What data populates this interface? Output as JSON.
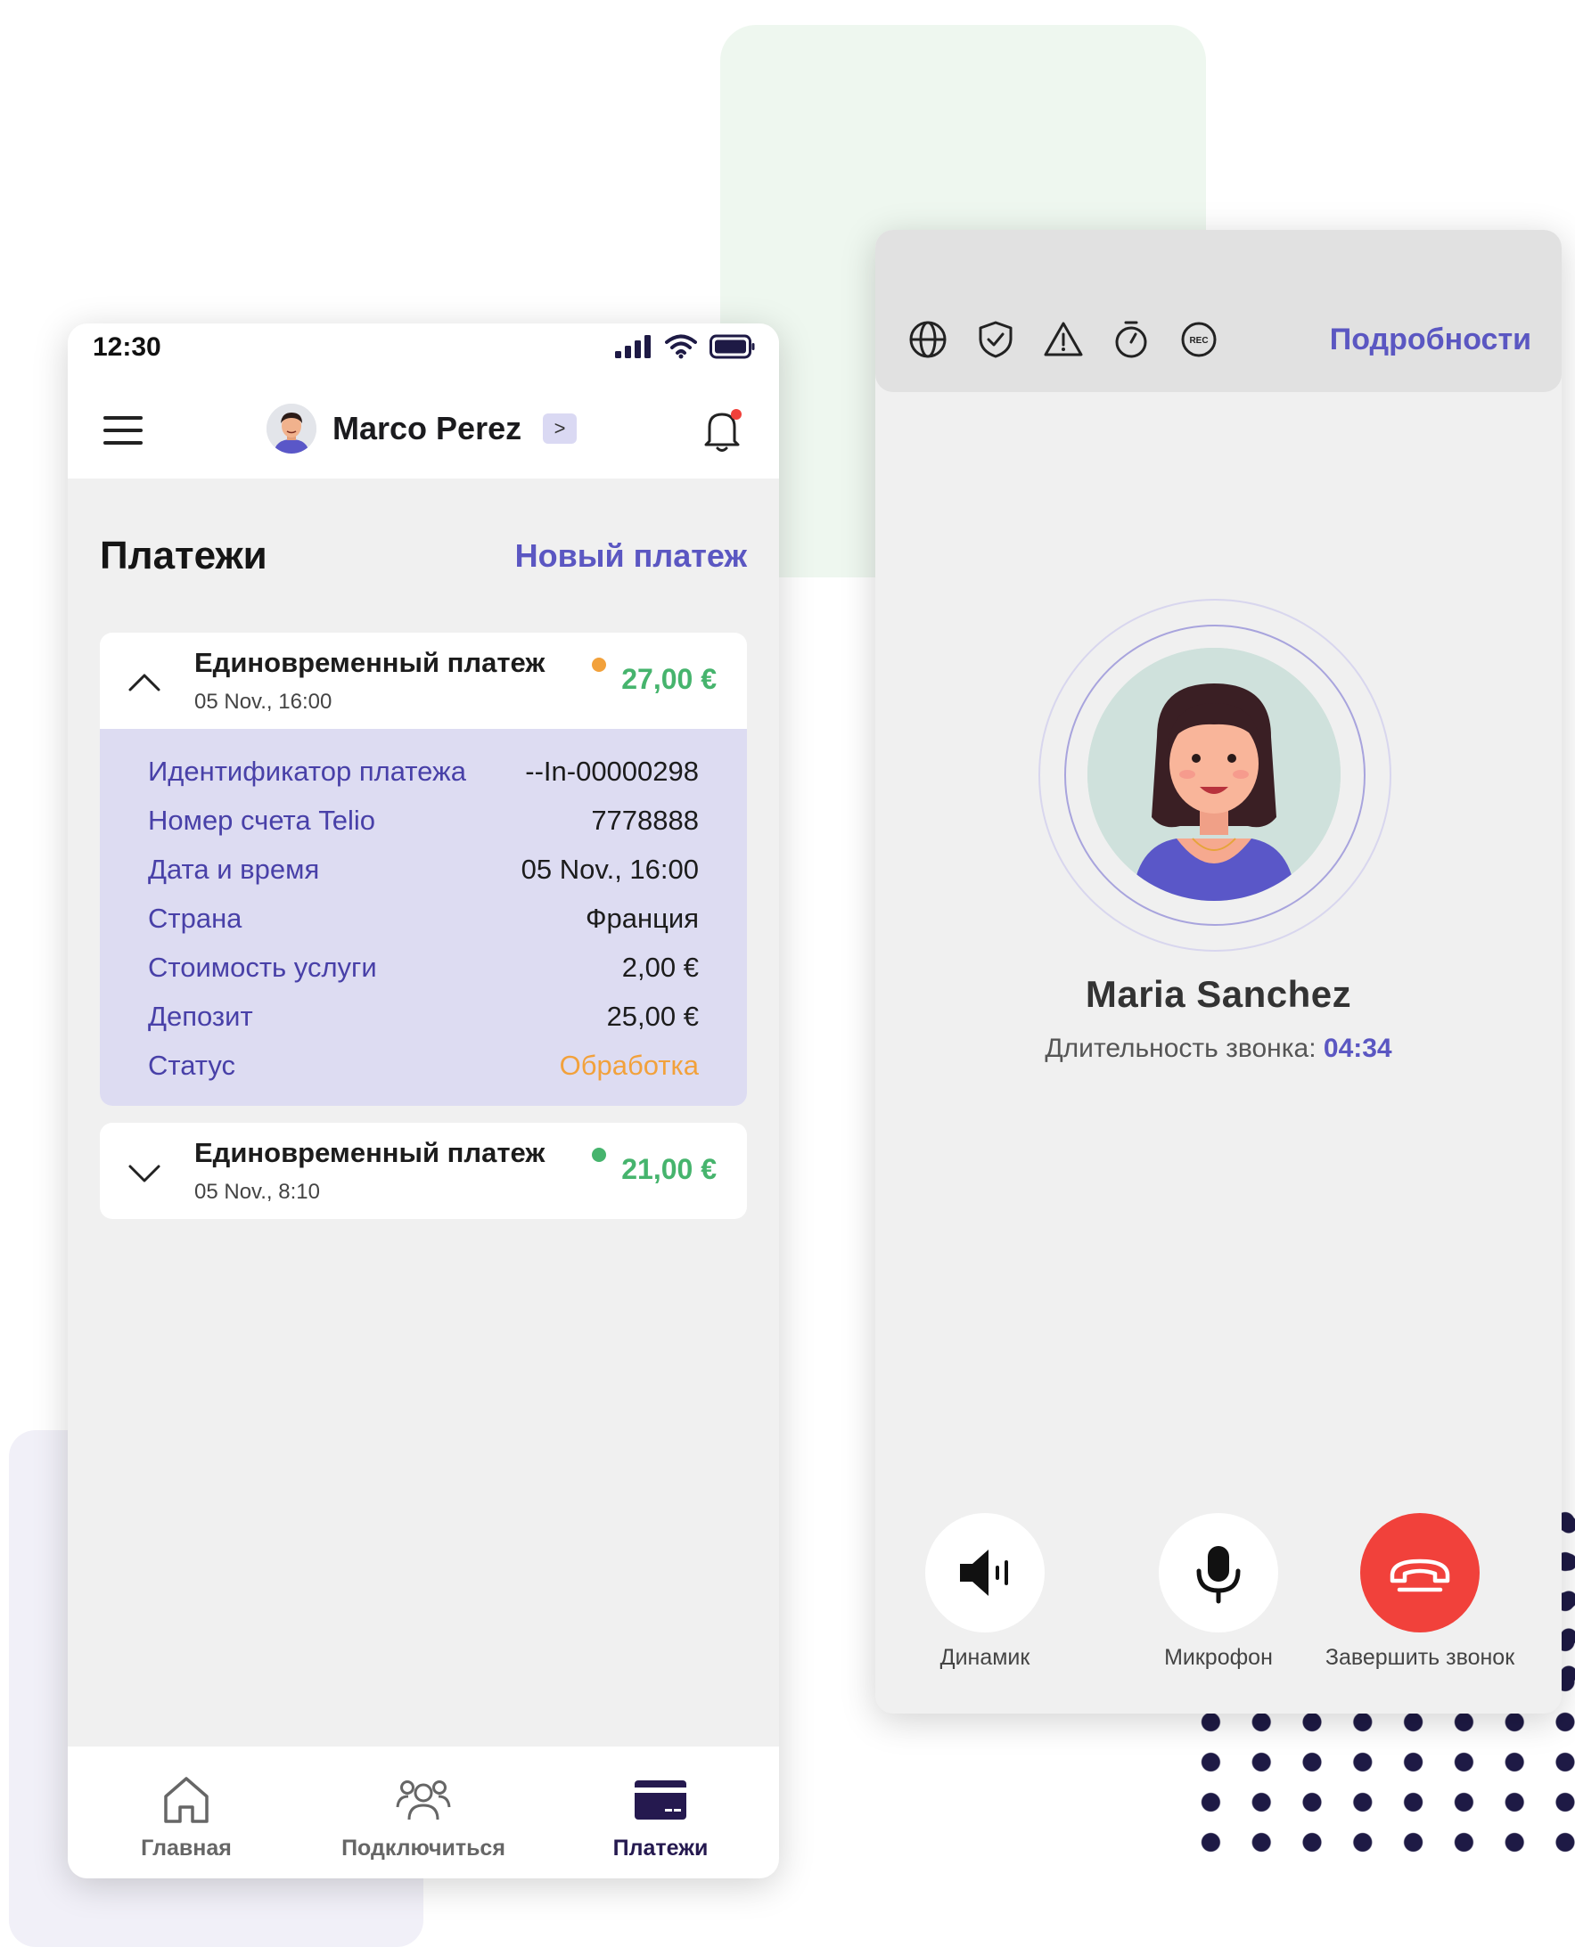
{
  "status_bar": {
    "time": "12:30"
  },
  "header": {
    "user_name": "Marco Perez",
    "chevron": ">"
  },
  "page": {
    "title": "Платежи",
    "new_payment": "Новый платеж"
  },
  "payments": [
    {
      "title": "Единовременный платеж",
      "date": "05 Nov., 16:00",
      "amount": "27,00 €",
      "status_dot_color": "#f2a13b",
      "expanded": true,
      "details": [
        {
          "key": "Идентификатор платежа",
          "value": "--In-00000298"
        },
        {
          "key": "Номер счета Telio",
          "value": "7778888"
        },
        {
          "key": "Дата и время",
          "value": "05 Nov., 16:00"
        },
        {
          "key": "Страна",
          "value": "Франция"
        },
        {
          "key": "Стоимость услуги",
          "value": "2,00 €"
        },
        {
          "key": "Депозит",
          "value": "25,00 €"
        },
        {
          "key": "Статус",
          "value": "Обработка"
        }
      ]
    },
    {
      "title": "Единовременный платеж",
      "date": "05 Nov., 8:10",
      "amount": "21,00 €",
      "status_dot_color": "#46b46d",
      "expanded": false
    }
  ],
  "bottom_nav": [
    {
      "label": "Главная",
      "icon": "home-icon",
      "active": false
    },
    {
      "label": "Подключиться",
      "icon": "people-icon",
      "active": false
    },
    {
      "label": "Платежи",
      "icon": "card-icon",
      "active": true
    }
  ],
  "call": {
    "toolbar_icons": [
      "globe-icon",
      "shield-icon",
      "warning-icon",
      "stopwatch-icon",
      "rec-icon"
    ],
    "rec_text": "REC",
    "details_link": "Подробности",
    "caller_name": "Maria Sanchez",
    "duration_label": "Длительность звонка:",
    "duration_value": "04:34",
    "controls": [
      {
        "label": "Динамик",
        "icon": "speaker-icon"
      },
      {
        "label": "Микрофон",
        "icon": "microphone-icon"
      },
      {
        "label": "Завершить звонок",
        "icon": "end-call-icon"
      }
    ]
  },
  "colors": {
    "accent": "#5b57c2",
    "amount_green": "#46b46d",
    "status_orange": "#f2a13b",
    "end_call_red": "#f1413b",
    "nav_active": "#25194f"
  }
}
